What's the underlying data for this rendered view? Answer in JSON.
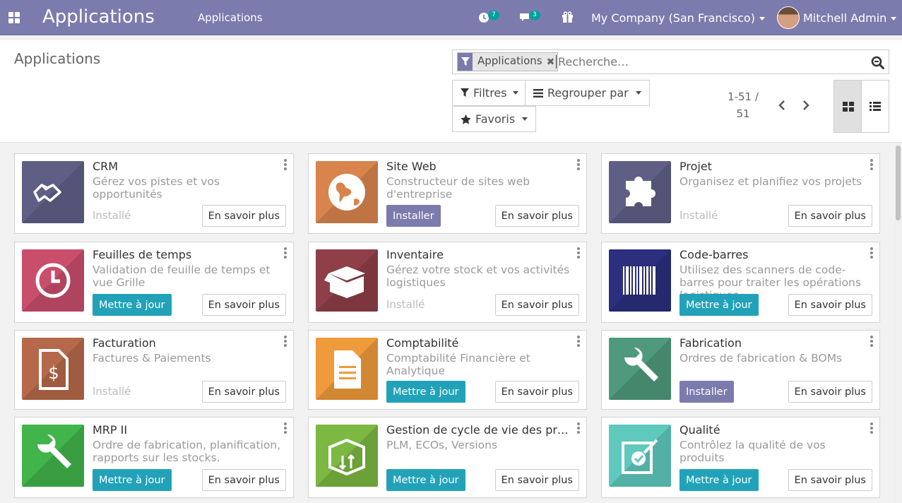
{
  "navbar": {
    "app_title": "Applications",
    "menu_item": "Applications",
    "activity_count": "7",
    "message_count": "3",
    "company": "My Company (San Francisco)",
    "user": "Mitchell Admin"
  },
  "control_panel": {
    "breadcrumb": "Applications",
    "search": {
      "facet_label": "Applications",
      "placeholder": "Recherche…"
    },
    "filters_label": "Filtres",
    "groupby_label": "Regrouper par",
    "favorites_label": "Favoris",
    "pager": {
      "range": "1-51 /",
      "total": "51"
    }
  },
  "colors": {
    "navbar": "#7c7bad",
    "primary_install": "#7c7bad",
    "upgrade": "#21a2b8"
  },
  "apps": [
    {
      "name": "CRM",
      "desc": "Gérez vos pistes et vos opportunités",
      "status": "Installé",
      "action": "",
      "learn": "En savoir plus",
      "icon": "handshake-icon",
      "bg": "#5f5f86"
    },
    {
      "name": "Site Web",
      "desc": "Constructeur de sites web d'entreprise",
      "status": "",
      "action": "Installer",
      "action_type": "install",
      "learn": "En savoir plus",
      "icon": "globe-icon",
      "bg": "#d9844d"
    },
    {
      "name": "Projet",
      "desc": "Organisez et planifiez vos projets",
      "status": "Installé",
      "action": "",
      "learn": "En savoir plus",
      "icon": "puzzle-icon",
      "bg": "#5f5f86"
    },
    {
      "name": "Feuilles de temps",
      "desc": "Validation de feuille de temps et vue Grille",
      "status": "",
      "action": "Mettre à jour",
      "action_type": "upgrade",
      "learn": "En savoir plus",
      "icon": "clock-icon",
      "bg": "#c94e6c"
    },
    {
      "name": "Inventaire",
      "desc": "Gérez votre stock et vos activités logistiques",
      "status": "Installé",
      "action": "",
      "learn": "En savoir plus",
      "icon": "box-icon",
      "bg": "#8e3f47"
    },
    {
      "name": "Code-barres",
      "desc": "Utilisez des scanners de code-barres pour traiter les opérations logistiques",
      "status": "",
      "action": "Mettre à jour",
      "action_type": "upgrade",
      "learn": "En savoir plus",
      "icon": "barcode-icon",
      "bg": "#2b2f7e"
    },
    {
      "name": "Facturation",
      "desc": "Factures & Paiements",
      "status": "Installé",
      "action": "",
      "learn": "En savoir plus",
      "icon": "invoice-icon",
      "bg": "#b5694a"
    },
    {
      "name": "Comptabilité",
      "desc": "Comptabilité Financière et Analytique",
      "status": "",
      "action": "Mettre à jour",
      "action_type": "upgrade",
      "learn": "En savoir plus",
      "icon": "document-icon",
      "bg": "#ef9a3b"
    },
    {
      "name": "Fabrication",
      "desc": "Ordres de fabrication & BOMs",
      "status": "",
      "action": "Installer",
      "action_type": "install",
      "learn": "En savoir plus",
      "icon": "wrench-icon",
      "bg": "#4f9a7d"
    },
    {
      "name": "MRP II",
      "desc": "Ordre de fabrication, planification, rapports sur les stocks.",
      "status": "",
      "action": "Mettre à jour",
      "action_type": "upgrade",
      "learn": "En savoir plus",
      "icon": "wrench-icon",
      "bg": "#41b44c"
    },
    {
      "name": "Gestion de cycle de vie des pro…",
      "desc": "PLM, ECOs, Versions",
      "status": "",
      "action": "Mettre à jour",
      "action_type": "upgrade",
      "learn": "En savoir plus",
      "icon": "package-arrows-icon",
      "bg": "#7cb842"
    },
    {
      "name": "Qualité",
      "desc": "Contrôlez la qualité de vos produits",
      "status": "",
      "action": "Mettre à jour",
      "action_type": "upgrade",
      "learn": "En savoir plus",
      "icon": "quality-check-icon",
      "bg": "#5fc9bd"
    }
  ]
}
